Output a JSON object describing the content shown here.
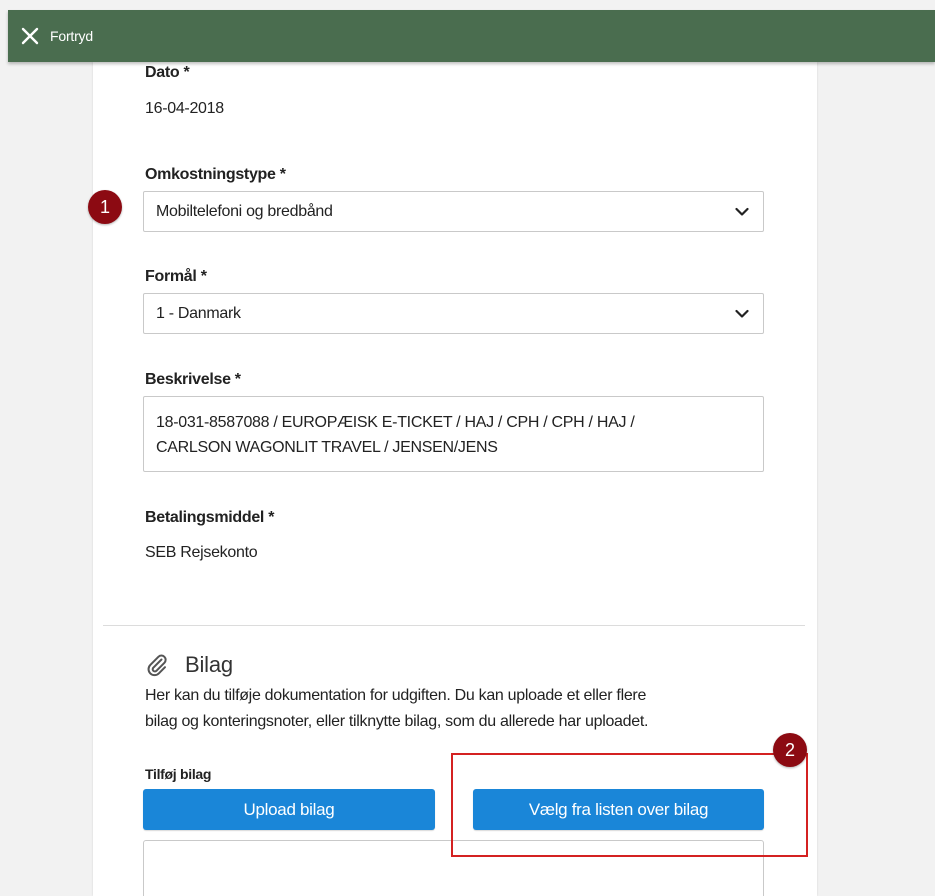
{
  "topbar": {
    "close_label": "Fortryd"
  },
  "form": {
    "dato": {
      "label": "Dato *",
      "value": "16-04-2018"
    },
    "omkostningstype": {
      "label": "Omkostningstype *",
      "value": "Mobiltelefoni og bredbånd"
    },
    "formaal": {
      "label": "Formål *",
      "value": "1 - Danmark"
    },
    "beskrivelse": {
      "label": "Beskrivelse *",
      "line1": "18-031-8587088 / EUROPÆISK E-TICKET / HAJ / CPH / CPH / HAJ /",
      "line2": "CARLSON WAGONLIT TRAVEL / JENSEN/JENS"
    },
    "betalingsmiddel": {
      "label": "Betalingsmiddel *",
      "value": "SEB Rejsekonto"
    }
  },
  "bilag": {
    "title": "Bilag",
    "desc_line1": "Her kan du tilføje dokumentation for udgiften. Du kan uploade et eller flere",
    "desc_line2": "bilag og konteringsnoter, eller tilknytte bilag, som du allerede har uploadet.",
    "add_label": "Tilføj bilag",
    "upload_button": "Upload bilag",
    "choose_button": "Vælg fra listen over bilag"
  },
  "annotations": {
    "badge1": "1",
    "badge2": "2"
  },
  "colors": {
    "topbar": "#4a6d4f",
    "primary_button": "#1a86d8",
    "badge": "#8c0a12",
    "highlight": "#d42121"
  }
}
